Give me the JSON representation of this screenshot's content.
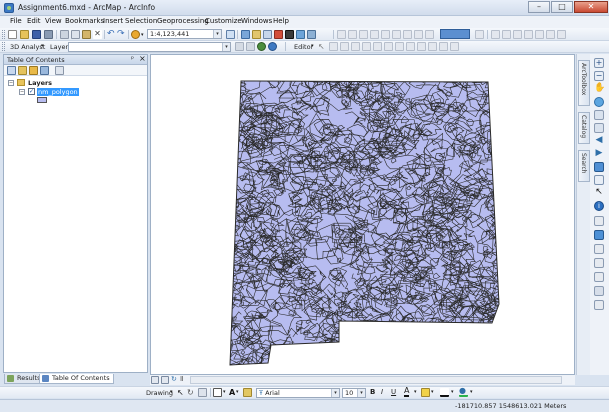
{
  "window": {
    "title": "Assignment6.mxd - ArcMap - ArcInfo",
    "controls": [
      "–",
      "□",
      "✕"
    ]
  },
  "menu": [
    "File",
    "Edit",
    "View",
    "Bookmarks",
    "Insert",
    "Selection",
    "Geoprocessing",
    "Customize",
    "Windows",
    "Help"
  ],
  "toolbar": {
    "scale": "1:4,123,441",
    "analyst_label": "3D Analyst",
    "layer_label": "Layer:",
    "layer_value": "",
    "editor_label": "Editor"
  },
  "toc": {
    "title": "Table Of Contents",
    "pin": "ᵖ",
    "close": "×",
    "group_name": "Layers",
    "layer_name": "nm_polygon",
    "layer_checked": "✓"
  },
  "tabs": {
    "results": "Results",
    "toc": "Table Of Contents"
  },
  "right_dock": {
    "arctoolbox": "ArcToolbox",
    "catalog": "Catalog",
    "search": "Search"
  },
  "drawing": {
    "label": "Drawing",
    "font": "Arial",
    "size": "10",
    "bold": "B",
    "italic": "I",
    "underline": "U",
    "font_color": "A"
  },
  "status": {
    "coordinates": "-181710.857  1548613.021 Meters"
  },
  "colors": {
    "polygon_fill": "#b7bcf0",
    "polygon_stroke": "#2a2a2a",
    "selection": "#3399ff",
    "chrome": "#d9e3f0"
  }
}
